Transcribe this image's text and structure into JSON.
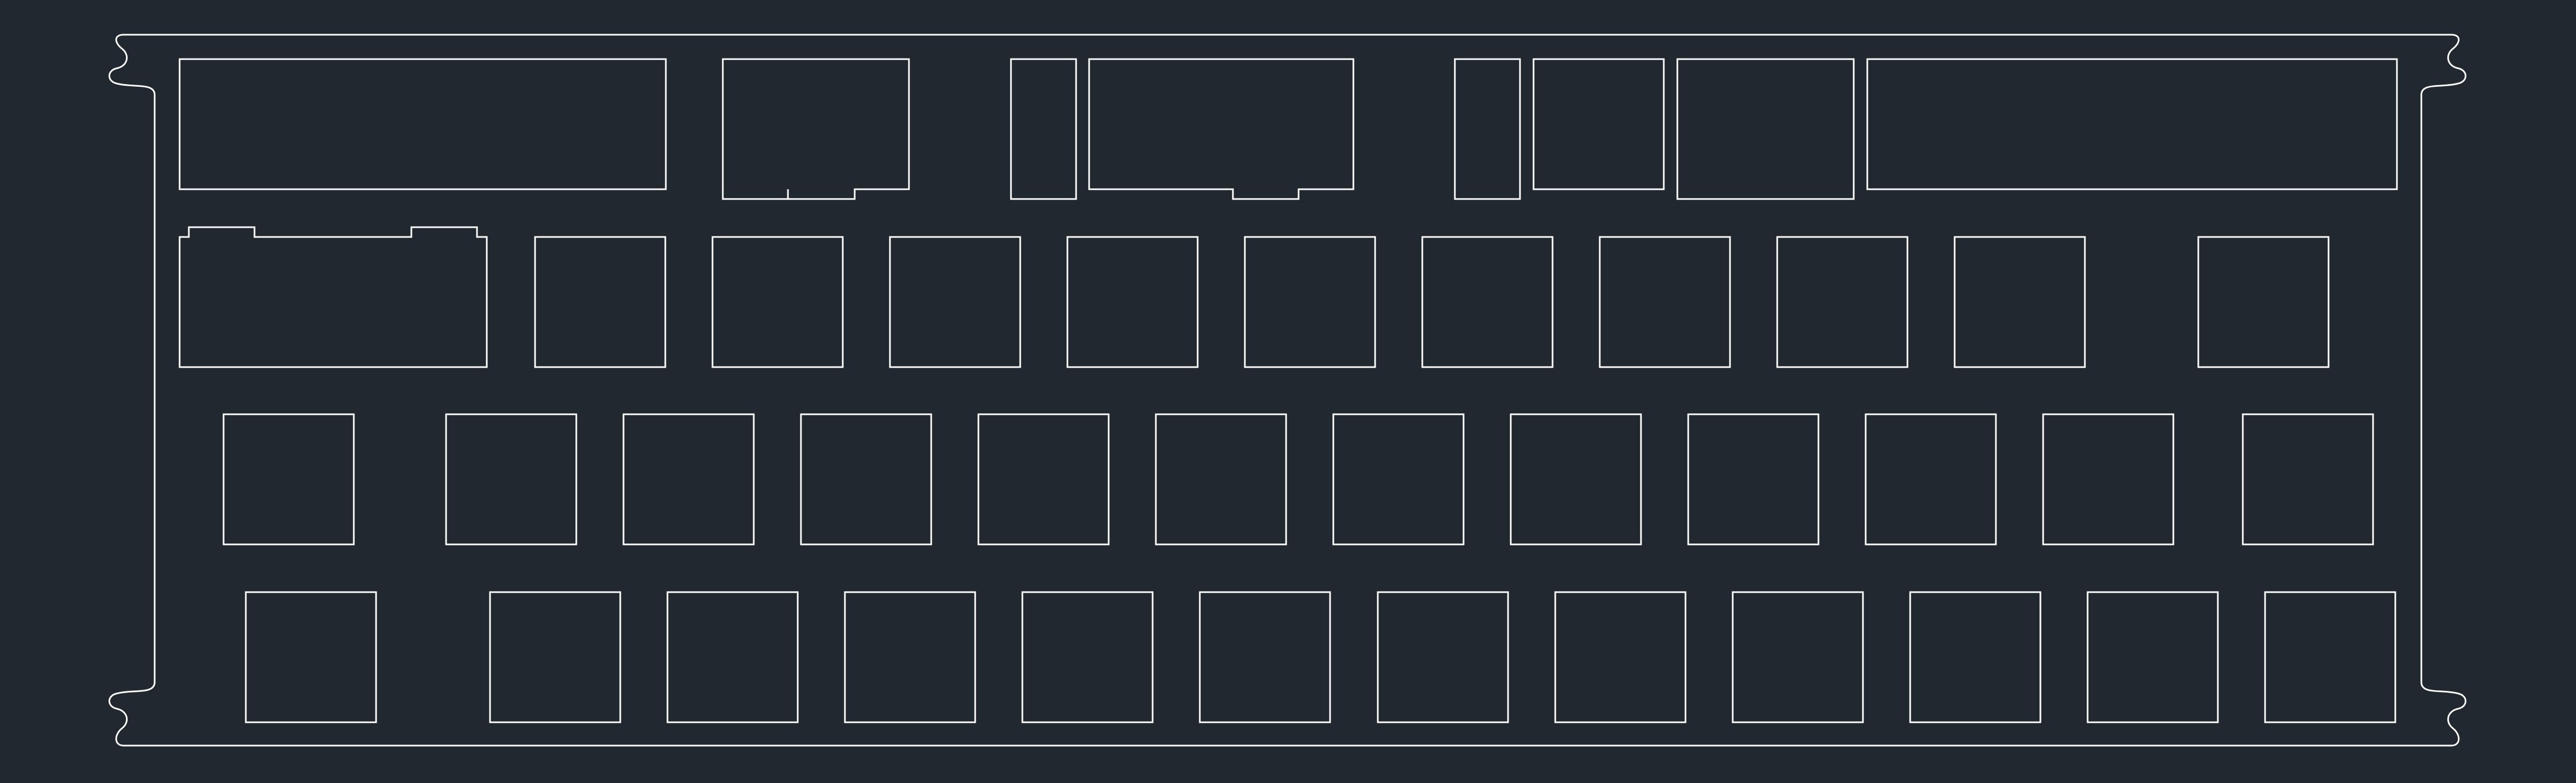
{
  "drawing": {
    "background_color": "#212830",
    "line_color": "#ffffff",
    "rows": [
      {
        "name": "row-1",
        "keys": 8
      },
      {
        "name": "row-2",
        "keys": 11
      },
      {
        "name": "row-3",
        "keys": 12
      },
      {
        "name": "row-4",
        "keys": 12
      }
    ]
  }
}
